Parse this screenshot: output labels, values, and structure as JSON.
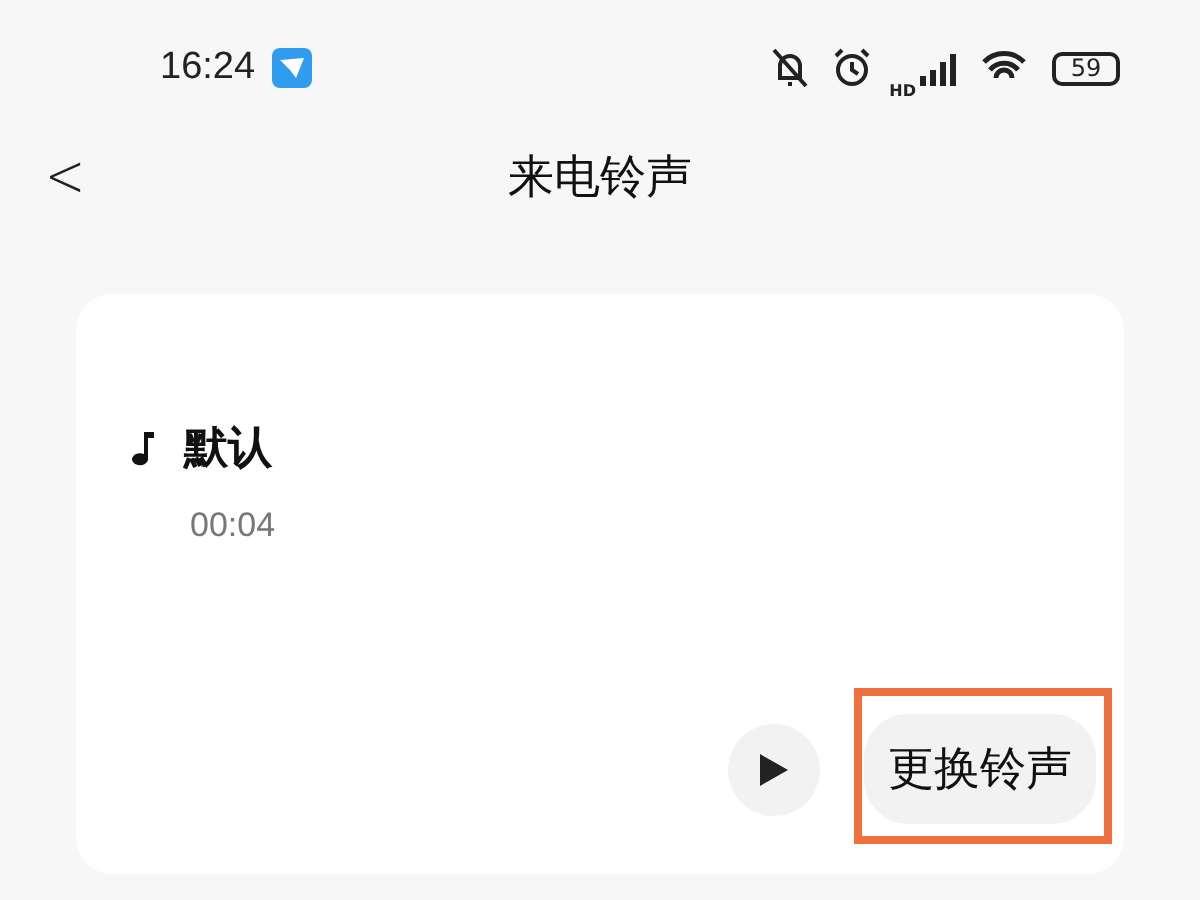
{
  "status_bar": {
    "time": "16:24",
    "network": "HD",
    "battery": "59"
  },
  "header": {
    "back": "<",
    "title": "来电铃声"
  },
  "ringtone": {
    "name": "默认",
    "duration": "00:04",
    "button": "更换铃声",
    "button_highlighted": true
  }
}
